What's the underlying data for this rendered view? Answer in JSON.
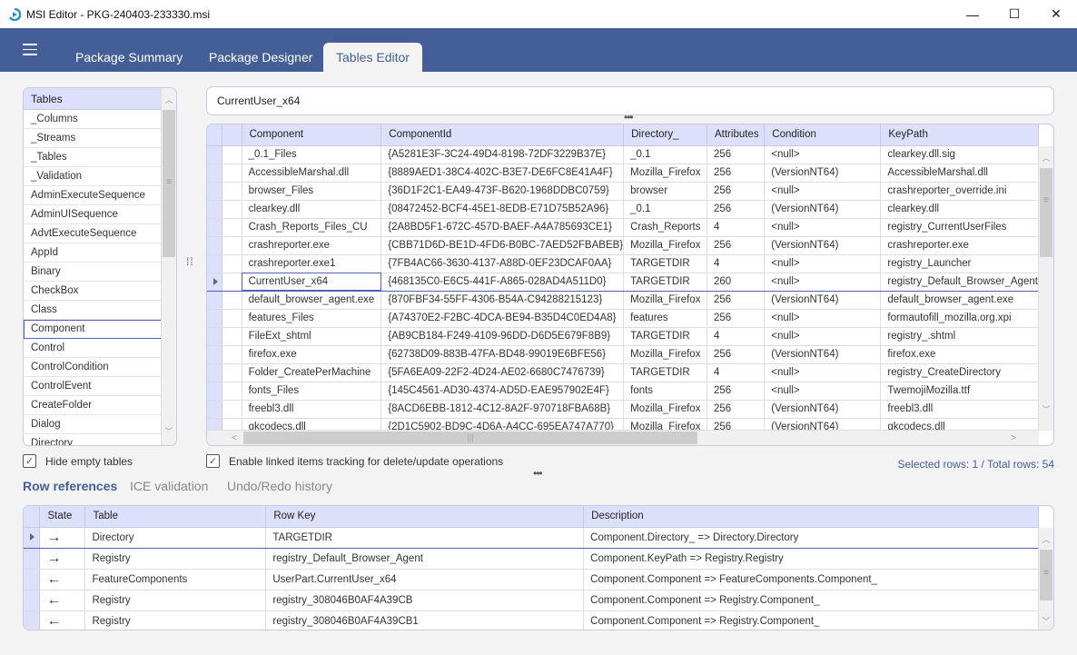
{
  "window": {
    "title": "MSI Editor - PKG-240403-233330.msi",
    "icon": "msi-editor-app-icon",
    "controls": {
      "minimize": "—",
      "maximize": "☐",
      "close": "✕"
    }
  },
  "header": {
    "menu_icon": "hamburger-menu-icon",
    "tabs": [
      {
        "label": "Package Summary",
        "active": false
      },
      {
        "label": "Package Designer",
        "active": false
      },
      {
        "label": "Tables Editor",
        "active": true
      }
    ]
  },
  "tables_panel": {
    "header": "Tables",
    "items": [
      "_Columns",
      "_Streams",
      "_Tables",
      "_Validation",
      "AdminExecuteSequence",
      "AdminUISequence",
      "AdvtExecuteSequence",
      "AppId",
      "Binary",
      "CheckBox",
      "Class",
      "Component",
      "Control",
      "ControlCondition",
      "ControlEvent",
      "CreateFolder",
      "Dialog",
      "Directory"
    ],
    "selected": "Component",
    "hide_empty_label": "Hide empty tables",
    "hide_empty_checked": true
  },
  "filter": {
    "value": "CurrentUser_x64",
    "placeholder": ""
  },
  "grid": {
    "columns": [
      "Component",
      "ComponentId",
      "Directory_",
      "Attributes",
      "Condition",
      "KeyPath"
    ],
    "rows": [
      [
        "_0.1_Files",
        "{A5281E3F-3C24-49D4-8198-72DF3229B37E}",
        "_0.1",
        "256",
        "<null>",
        "clearkey.dll.sig"
      ],
      [
        "AccessibleMarshal.dll",
        "{8889AED1-38C4-402C-B3E7-DE6FC8E41A4F}",
        "Mozilla_Firefox",
        "256",
        "(VersionNT64)",
        "AccessibleMarshal.dll"
      ],
      [
        "browser_Files",
        "{36D1F2C1-EA49-473F-B620-1968DDBC0759}",
        "browser",
        "256",
        "<null>",
        "crashreporter_override.ini"
      ],
      [
        "clearkey.dll",
        "{08472452-BCF4-45E1-8EDB-E71D75B52A96}",
        "_0.1",
        "256",
        "(VersionNT64)",
        "clearkey.dll"
      ],
      [
        "Crash_Reports_Files_CU",
        "{2A8BD5F1-672C-457D-BAEF-A4A785693CE1}",
        "Crash_Reports",
        "4",
        "<null>",
        "registry_CurrentUserFiles"
      ],
      [
        "crashreporter.exe",
        "{CBB71D6D-BE1D-4FD6-B0BC-7AED52FBABEB}",
        "Mozilla_Firefox",
        "256",
        "(VersionNT64)",
        "crashreporter.exe"
      ],
      [
        "crashreporter.exe1",
        "{7FB4AC66-3630-4137-A88D-0EF23DCAF0AA}",
        "TARGETDIR",
        "4",
        "<null>",
        "registry_Launcher"
      ],
      [
        "CurrentUser_x64",
        "{468135C0-E6C5-441F-A865-028AD4A511D0}",
        "TARGETDIR",
        "260",
        "<null>",
        "registry_Default_Browser_Agent"
      ],
      [
        "default_browser_agent.exe",
        "{870FBF34-55FF-4306-B54A-C94288215123}",
        "Mozilla_Firefox",
        "256",
        "(VersionNT64)",
        "default_browser_agent.exe"
      ],
      [
        "features_Files",
        "{A74370E2-F2BC-4DCA-BE94-B35D4C0ED4A8}",
        "features",
        "256",
        "<null>",
        "formautofill_mozilla.org.xpi"
      ],
      [
        "FileExt_shtml",
        "{AB9CB184-F249-4109-96DD-D6D5E679F8B9}",
        "TARGETDIR",
        "4",
        "<null>",
        "registry_.shtml"
      ],
      [
        "firefox.exe",
        "{62738D09-883B-47FA-BD48-99019E6BFE56}",
        "Mozilla_Firefox",
        "256",
        "(VersionNT64)",
        "firefox.exe"
      ],
      [
        "Folder_CreatePerMachine",
        "{5FA6EA09-22F2-4D24-AE02-6680C7476739}",
        "TARGETDIR",
        "4",
        "<null>",
        "registry_CreateDirectory"
      ],
      [
        "fonts_Files",
        "{145C4561-AD30-4374-AD5D-EAE957902E4F}",
        "fonts",
        "256",
        "<null>",
        "TwemojiMozilla.ttf"
      ],
      [
        "freebl3.dll",
        "{8ACD6EBB-1812-4C12-8A2F-970718FBA68B}",
        "Mozilla_Firefox",
        "256",
        "(VersionNT64)",
        "freebl3.dll"
      ],
      [
        "gkcodecs.dll",
        "{2D1C5902-BD9C-4D6A-A4CC-695EA747A770}",
        "Mozilla_Firefox",
        "256",
        "(VersionNT64)",
        "gkcodecs.dll"
      ]
    ],
    "selected_row": 7,
    "linked_tracking_label": "Enable linked items tracking for delete/update operations",
    "linked_tracking_checked": true,
    "status": "Selected rows: 1 / Total rows: 54"
  },
  "bottom_tabs": [
    {
      "label": "Row references",
      "active": true
    },
    {
      "label": "ICE validation",
      "active": false
    },
    {
      "label": "Undo/Redo history",
      "active": false
    }
  ],
  "references": {
    "columns": [
      "State",
      "Table",
      "Row Key",
      "Description"
    ],
    "rows": [
      {
        "state": "outgoing",
        "glyph": "→",
        "table": "Directory",
        "row_key": "TARGETDIR",
        "description": "Component.Directory_ => Directory.Directory"
      },
      {
        "state": "outgoing",
        "glyph": "→",
        "table": "Registry",
        "row_key": "registry_Default_Browser_Agent",
        "description": "Component.KeyPath => Registry.Registry"
      },
      {
        "state": "incoming",
        "glyph": "←",
        "table": "FeatureComponents",
        "row_key": "UserPart.CurrentUser_x64",
        "description": "Component.Component => FeatureComponents.Component_"
      },
      {
        "state": "incoming",
        "glyph": "←",
        "table": "Registry",
        "row_key": "registry_308046B0AF4A39CB",
        "description": "Component.Component => Registry.Component_"
      },
      {
        "state": "incoming",
        "glyph": "←",
        "table": "Registry",
        "row_key": "registry_308046B0AF4A39CB1",
        "description": "Component.Component => Registry.Component_"
      }
    ],
    "selected_row": 0
  },
  "colors": {
    "accent": "#445e98",
    "header_fill": "#dde0fa",
    "selection_border": "#5060c0"
  }
}
